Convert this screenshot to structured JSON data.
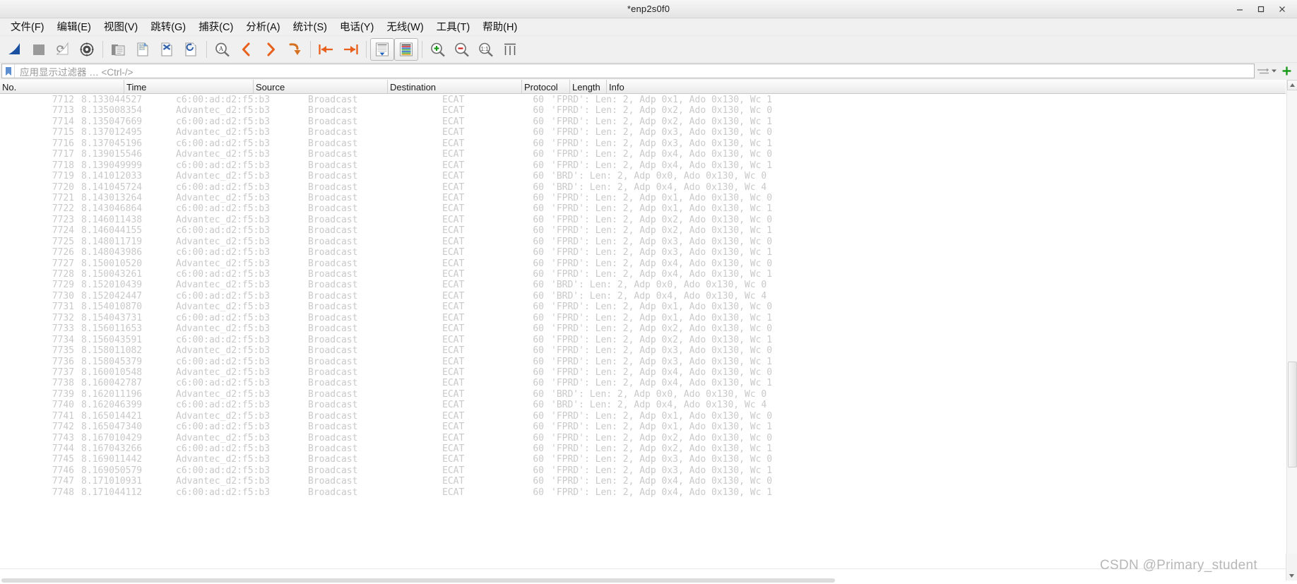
{
  "window": {
    "title": "*enp2s0f0",
    "minimize_label": "–",
    "maximize_label": "□",
    "close_label": "✕"
  },
  "menubar": {
    "items": [
      {
        "label": "文件(F)",
        "accel": "F"
      },
      {
        "label": "编辑(E)",
        "accel": "E"
      },
      {
        "label": "视图(V)",
        "accel": "V"
      },
      {
        "label": "跳转(G)",
        "accel": "G"
      },
      {
        "label": "捕获(C)",
        "accel": "C"
      },
      {
        "label": "分析(A)",
        "accel": "A"
      },
      {
        "label": "统计(S)",
        "accel": "S"
      },
      {
        "label": "电话(Y)",
        "accel": "Y"
      },
      {
        "label": "无线(W)",
        "accel": "W"
      },
      {
        "label": "工具(T)",
        "accel": "T"
      },
      {
        "label": "帮助(H)",
        "accel": "H"
      }
    ]
  },
  "toolbar": {
    "buttons": [
      {
        "icon": "start-capture-shark-fin-icon",
        "tooltip": "开始捕获"
      },
      {
        "icon": "stop-capture-square-icon",
        "tooltip": "停止捕获"
      },
      {
        "icon": "restart-capture-icon",
        "tooltip": "重新开始捕获"
      },
      {
        "icon": "capture-options-gear-icon",
        "tooltip": "捕获选项"
      },
      {
        "sep": true
      },
      {
        "icon": "open-file-folder-icon",
        "tooltip": "打开"
      },
      {
        "icon": "save-file-icon",
        "tooltip": "保存"
      },
      {
        "icon": "close-file-icon",
        "tooltip": "关闭"
      },
      {
        "icon": "reload-file-icon",
        "tooltip": "重新载入"
      },
      {
        "sep": true
      },
      {
        "icon": "find-packet-magnifier-icon",
        "tooltip": "查找分组"
      },
      {
        "icon": "go-back-chevron-icon",
        "tooltip": "后退"
      },
      {
        "icon": "go-forward-chevron-icon",
        "tooltip": "前进"
      },
      {
        "icon": "go-to-packet-arrow-icon",
        "tooltip": "转到分组"
      },
      {
        "sep": true
      },
      {
        "icon": "go-to-first-packet-icon",
        "tooltip": "转到第一个分组"
      },
      {
        "icon": "go-to-last-packet-icon",
        "tooltip": "转到最后一个分组"
      },
      {
        "sep": true
      },
      {
        "icon": "auto-scroll-live-capture-icon",
        "tooltip": "实时捕获时自动滚动"
      },
      {
        "icon": "colorize-packet-list-icon",
        "tooltip": "着色分组列表"
      },
      {
        "sep": true
      },
      {
        "icon": "zoom-in-icon",
        "tooltip": "放大"
      },
      {
        "icon": "zoom-out-icon",
        "tooltip": "缩小"
      },
      {
        "icon": "zoom-reset-icon",
        "tooltip": "正常大小"
      },
      {
        "icon": "resize-columns-icon",
        "tooltip": "调整列宽"
      }
    ]
  },
  "filter": {
    "bookmark_icon": "filter-bookmark-icon",
    "placeholder": "应用显示过滤器 … <Ctrl-/>",
    "value": "",
    "expand_icon": "filter-expression-arrow-icon",
    "add_icon": "add-filter-button-green-plus-icon"
  },
  "packet_list": {
    "columns": [
      {
        "key": "no",
        "label": "No."
      },
      {
        "key": "time",
        "label": "Time"
      },
      {
        "key": "src",
        "label": "Source"
      },
      {
        "key": "dst",
        "label": "Destination"
      },
      {
        "key": "proto",
        "label": "Protocol"
      },
      {
        "key": "len",
        "label": "Length"
      },
      {
        "key": "info",
        "label": "Info"
      }
    ],
    "rows": [
      {
        "no": "7712",
        "time": "8.133044527",
        "src": "c6:00:ad:d2:f5:b3",
        "dst": "Broadcast",
        "proto": "ECAT",
        "len": "60",
        "info": "'FPRD': Len: 2, Adp 0x1, Ado 0x130, Wc 1"
      },
      {
        "no": "7713",
        "time": "8.135008354",
        "src": "Advantec_d2:f5:b3",
        "dst": "Broadcast",
        "proto": "ECAT",
        "len": "60",
        "info": "'FPRD': Len: 2, Adp 0x2, Ado 0x130, Wc 0"
      },
      {
        "no": "7714",
        "time": "8.135047669",
        "src": "c6:00:ad:d2:f5:b3",
        "dst": "Broadcast",
        "proto": "ECAT",
        "len": "60",
        "info": "'FPRD': Len: 2, Adp 0x2, Ado 0x130, Wc 1"
      },
      {
        "no": "7715",
        "time": "8.137012495",
        "src": "Advantec_d2:f5:b3",
        "dst": "Broadcast",
        "proto": "ECAT",
        "len": "60",
        "info": "'FPRD': Len: 2, Adp 0x3, Ado 0x130, Wc 0"
      },
      {
        "no": "7716",
        "time": "8.137045196",
        "src": "c6:00:ad:d2:f5:b3",
        "dst": "Broadcast",
        "proto": "ECAT",
        "len": "60",
        "info": "'FPRD': Len: 2, Adp 0x3, Ado 0x130, Wc 1"
      },
      {
        "no": "7717",
        "time": "8.139015546",
        "src": "Advantec_d2:f5:b3",
        "dst": "Broadcast",
        "proto": "ECAT",
        "len": "60",
        "info": "'FPRD': Len: 2, Adp 0x4, Ado 0x130, Wc 0"
      },
      {
        "no": "7718",
        "time": "8.139049999",
        "src": "c6:00:ad:d2:f5:b3",
        "dst": "Broadcast",
        "proto": "ECAT",
        "len": "60",
        "info": "'FPRD': Len: 2, Adp 0x4, Ado 0x130, Wc 1"
      },
      {
        "no": "7719",
        "time": "8.141012033",
        "src": "Advantec_d2:f5:b3",
        "dst": "Broadcast",
        "proto": "ECAT",
        "len": "60",
        "info": "'BRD': Len: 2, Adp 0x0, Ado 0x130, Wc 0"
      },
      {
        "no": "7720",
        "time": "8.141045724",
        "src": "c6:00:ad:d2:f5:b3",
        "dst": "Broadcast",
        "proto": "ECAT",
        "len": "60",
        "info": "'BRD': Len: 2, Adp 0x4, Ado 0x130, Wc 4"
      },
      {
        "no": "7721",
        "time": "8.143013264",
        "src": "Advantec_d2:f5:b3",
        "dst": "Broadcast",
        "proto": "ECAT",
        "len": "60",
        "info": "'FPRD': Len: 2, Adp 0x1, Ado 0x130, Wc 0"
      },
      {
        "no": "7722",
        "time": "8.143046864",
        "src": "c6:00:ad:d2:f5:b3",
        "dst": "Broadcast",
        "proto": "ECAT",
        "len": "60",
        "info": "'FPRD': Len: 2, Adp 0x1, Ado 0x130, Wc 1"
      },
      {
        "no": "7723",
        "time": "8.146011438",
        "src": "Advantec_d2:f5:b3",
        "dst": "Broadcast",
        "proto": "ECAT",
        "len": "60",
        "info": "'FPRD': Len: 2, Adp 0x2, Ado 0x130, Wc 0"
      },
      {
        "no": "7724",
        "time": "8.146044155",
        "src": "c6:00:ad:d2:f5:b3",
        "dst": "Broadcast",
        "proto": "ECAT",
        "len": "60",
        "info": "'FPRD': Len: 2, Adp 0x2, Ado 0x130, Wc 1"
      },
      {
        "no": "7725",
        "time": "8.148011719",
        "src": "Advantec_d2:f5:b3",
        "dst": "Broadcast",
        "proto": "ECAT",
        "len": "60",
        "info": "'FPRD': Len: 2, Adp 0x3, Ado 0x130, Wc 0"
      },
      {
        "no": "7726",
        "time": "8.148043986",
        "src": "c6:00:ad:d2:f5:b3",
        "dst": "Broadcast",
        "proto": "ECAT",
        "len": "60",
        "info": "'FPRD': Len: 2, Adp 0x3, Ado 0x130, Wc 1"
      },
      {
        "no": "7727",
        "time": "8.150010520",
        "src": "Advantec_d2:f5:b3",
        "dst": "Broadcast",
        "proto": "ECAT",
        "len": "60",
        "info": "'FPRD': Len: 2, Adp 0x4, Ado 0x130, Wc 0"
      },
      {
        "no": "7728",
        "time": "8.150043261",
        "src": "c6:00:ad:d2:f5:b3",
        "dst": "Broadcast",
        "proto": "ECAT",
        "len": "60",
        "info": "'FPRD': Len: 2, Adp 0x4, Ado 0x130, Wc 1"
      },
      {
        "no": "7729",
        "time": "8.152010439",
        "src": "Advantec_d2:f5:b3",
        "dst": "Broadcast",
        "proto": "ECAT",
        "len": "60",
        "info": "'BRD': Len: 2, Adp 0x0, Ado 0x130, Wc 0"
      },
      {
        "no": "7730",
        "time": "8.152042447",
        "src": "c6:00:ad:d2:f5:b3",
        "dst": "Broadcast",
        "proto": "ECAT",
        "len": "60",
        "info": "'BRD': Len: 2, Adp 0x4, Ado 0x130, Wc 4"
      },
      {
        "no": "7731",
        "time": "8.154010870",
        "src": "Advantec_d2:f5:b3",
        "dst": "Broadcast",
        "proto": "ECAT",
        "len": "60",
        "info": "'FPRD': Len: 2, Adp 0x1, Ado 0x130, Wc 0"
      },
      {
        "no": "7732",
        "time": "8.154043731",
        "src": "c6:00:ad:d2:f5:b3",
        "dst": "Broadcast",
        "proto": "ECAT",
        "len": "60",
        "info": "'FPRD': Len: 2, Adp 0x1, Ado 0x130, Wc 1"
      },
      {
        "no": "7733",
        "time": "8.156011653",
        "src": "Advantec_d2:f5:b3",
        "dst": "Broadcast",
        "proto": "ECAT",
        "len": "60",
        "info": "'FPRD': Len: 2, Adp 0x2, Ado 0x130, Wc 0"
      },
      {
        "no": "7734",
        "time": "8.156043591",
        "src": "c6:00:ad:d2:f5:b3",
        "dst": "Broadcast",
        "proto": "ECAT",
        "len": "60",
        "info": "'FPRD': Len: 2, Adp 0x2, Ado 0x130, Wc 1"
      },
      {
        "no": "7735",
        "time": "8.158011082",
        "src": "Advantec_d2:f5:b3",
        "dst": "Broadcast",
        "proto": "ECAT",
        "len": "60",
        "info": "'FPRD': Len: 2, Adp 0x3, Ado 0x130, Wc 0"
      },
      {
        "no": "7736",
        "time": "8.158045379",
        "src": "c6:00:ad:d2:f5:b3",
        "dst": "Broadcast",
        "proto": "ECAT",
        "len": "60",
        "info": "'FPRD': Len: 2, Adp 0x3, Ado 0x130, Wc 1"
      },
      {
        "no": "7737",
        "time": "8.160010548",
        "src": "Advantec_d2:f5:b3",
        "dst": "Broadcast",
        "proto": "ECAT",
        "len": "60",
        "info": "'FPRD': Len: 2, Adp 0x4, Ado 0x130, Wc 0"
      },
      {
        "no": "7738",
        "time": "8.160042787",
        "src": "c6:00:ad:d2:f5:b3",
        "dst": "Broadcast",
        "proto": "ECAT",
        "len": "60",
        "info": "'FPRD': Len: 2, Adp 0x4, Ado 0x130, Wc 1"
      },
      {
        "no": "7739",
        "time": "8.162011196",
        "src": "Advantec_d2:f5:b3",
        "dst": "Broadcast",
        "proto": "ECAT",
        "len": "60",
        "info": "'BRD': Len: 2, Adp 0x0, Ado 0x130, Wc 0"
      },
      {
        "no": "7740",
        "time": "8.162046399",
        "src": "c6:00:ad:d2:f5:b3",
        "dst": "Broadcast",
        "proto": "ECAT",
        "len": "60",
        "info": "'BRD': Len: 2, Adp 0x4, Ado 0x130, Wc 4"
      },
      {
        "no": "7741",
        "time": "8.165014421",
        "src": "Advantec_d2:f5:b3",
        "dst": "Broadcast",
        "proto": "ECAT",
        "len": "60",
        "info": "'FPRD': Len: 2, Adp 0x1, Ado 0x130, Wc 0"
      },
      {
        "no": "7742",
        "time": "8.165047340",
        "src": "c6:00:ad:d2:f5:b3",
        "dst": "Broadcast",
        "proto": "ECAT",
        "len": "60",
        "info": "'FPRD': Len: 2, Adp 0x1, Ado 0x130, Wc 1"
      },
      {
        "no": "7743",
        "time": "8.167010429",
        "src": "Advantec_d2:f5:b3",
        "dst": "Broadcast",
        "proto": "ECAT",
        "len": "60",
        "info": "'FPRD': Len: 2, Adp 0x2, Ado 0x130, Wc 0"
      },
      {
        "no": "7744",
        "time": "8.167043266",
        "src": "c6:00:ad:d2:f5:b3",
        "dst": "Broadcast",
        "proto": "ECAT",
        "len": "60",
        "info": "'FPRD': Len: 2, Adp 0x2, Ado 0x130, Wc 1"
      },
      {
        "no": "7745",
        "time": "8.169011442",
        "src": "Advantec_d2:f5:b3",
        "dst": "Broadcast",
        "proto": "ECAT",
        "len": "60",
        "info": "'FPRD': Len: 2, Adp 0x3, Ado 0x130, Wc 0"
      },
      {
        "no": "7746",
        "time": "8.169050579",
        "src": "c6:00:ad:d2:f5:b3",
        "dst": "Broadcast",
        "proto": "ECAT",
        "len": "60",
        "info": "'FPRD': Len: 2, Adp 0x3, Ado 0x130, Wc 1"
      },
      {
        "no": "7747",
        "time": "8.171010931",
        "src": "Advantec_d2:f5:b3",
        "dst": "Broadcast",
        "proto": "ECAT",
        "len": "60",
        "info": "'FPRD': Len: 2, Adp 0x4, Ado 0x130, Wc 0"
      },
      {
        "no": "7748",
        "time": "8.171044112",
        "src": "c6:00:ad:d2:f5:b3",
        "dst": "Broadcast",
        "proto": "ECAT",
        "len": "60",
        "info": "'FPRD': Len: 2, Adp 0x4, Ado 0x130, Wc 1"
      }
    ]
  },
  "watermark": {
    "text": "CSDN @Primary_student"
  },
  "colors": {
    "accent_orange": "#e8601c",
    "shark_blue": "#1b4fa0",
    "green_plus": "#1a9a1a",
    "row_text": "#c9c9c9",
    "header_text": "#1a1a1a",
    "chrome_bg": "#f0f0f0"
  }
}
